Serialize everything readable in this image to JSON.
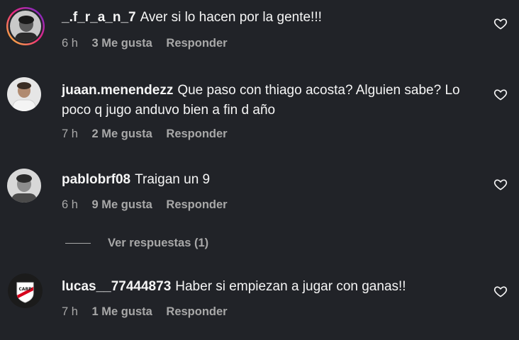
{
  "comments": [
    {
      "username": "_.f_r_a_n_7",
      "text": "Aver si lo hacen por la gente!!!",
      "time": "6 h",
      "likes": "3 Me gusta",
      "reply_label": "Responder",
      "avatar": "user-avatar-story-ring"
    },
    {
      "username": "juaan.menendezz",
      "text": "Que paso con thiago acosta? Alguien sabe? Lo poco q jugo anduvo bien a fin d año",
      "time": "7 h",
      "likes": "2 Me gusta",
      "reply_label": "Responder",
      "avatar": "user-avatar-photo"
    },
    {
      "username": "pablobrf08",
      "text": "Traigan un 9",
      "time": "6 h",
      "likes": "9 Me gusta",
      "reply_label": "Responder",
      "avatar": "user-avatar-photo",
      "view_replies": "Ver respuestas (1)"
    },
    {
      "username": "lucas__77444873",
      "text": "Haber si empiezan a jugar con ganas!!",
      "time": "7 h",
      "likes": "1 Me gusta",
      "reply_label": "Responder",
      "avatar": "club-crest-avatar"
    }
  ],
  "colors": {
    "background": "#212328",
    "primary_text": "#f5f5f5",
    "secondary_text": "#a8a8a8",
    "story_ring_start": "#f9ce34",
    "story_ring_end": "#ee2a7b"
  },
  "icons": {
    "like": "heart-outline-icon"
  }
}
